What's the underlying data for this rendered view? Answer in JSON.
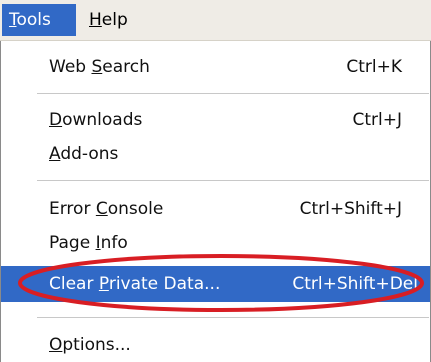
{
  "menubar": {
    "tools": {
      "accel": "T",
      "rest": "ools"
    },
    "help": {
      "accel": "H",
      "rest": "elp"
    }
  },
  "menu": {
    "web_search": {
      "pre": "Web ",
      "accel": "S",
      "post": "earch",
      "shortcut": "Ctrl+K"
    },
    "downloads": {
      "pre": "",
      "accel": "D",
      "post": "ownloads",
      "shortcut": "Ctrl+J"
    },
    "addons": {
      "pre": "",
      "accel": "A",
      "post": "dd-ons"
    },
    "error_console": {
      "pre": "Error ",
      "accel": "C",
      "post": "onsole",
      "shortcut": "Ctrl+Shift+J"
    },
    "page_info": {
      "pre": "Page ",
      "accel": "I",
      "post": "nfo"
    },
    "clear_private_data": {
      "pre": "Clear ",
      "accel": "P",
      "post": "rivate Data...",
      "shortcut": "Ctrl+Shift+Del"
    },
    "options": {
      "pre": "",
      "accel": "O",
      "post": "ptions..."
    }
  },
  "colors": {
    "highlight": "#3169c6",
    "annotation_ellipse": "#d81e24"
  }
}
